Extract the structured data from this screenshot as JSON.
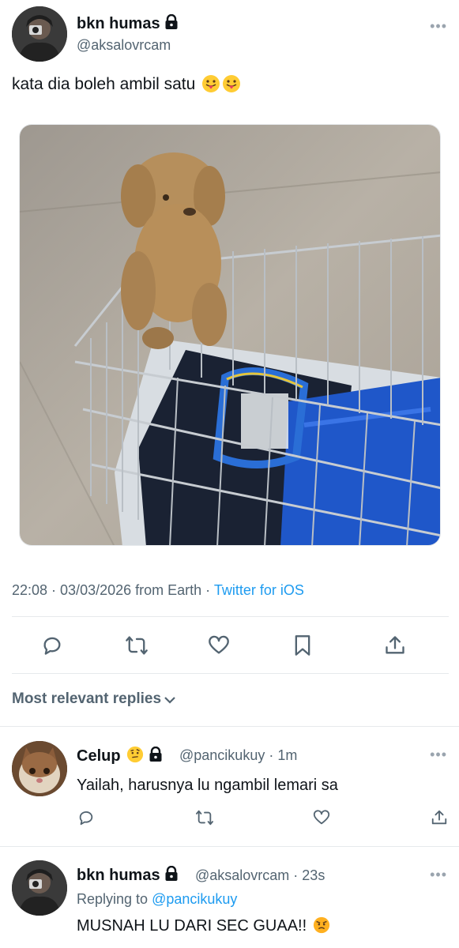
{
  "tweet": {
    "author_name": "bkn humas",
    "author_handle": "@aksalovrcam",
    "text": "kata dia boleh ambil satu",
    "timestamp": "22:08 · 03/03/2026 from Earth · ",
    "client": "Twitter for iOS",
    "icons": [
      "lock-icon",
      "tongue-emoji",
      "more-icon",
      "reply-icon",
      "retweet-icon",
      "like-icon",
      "bookmark-icon",
      "share-icon"
    ]
  },
  "replies_header": {
    "label": "Most relevant replies"
  },
  "replies": [
    {
      "author_name": "Celup",
      "author_handle": "@pancikukuy · 1m",
      "text": "Yailah, harusnya lu ngambil lemari sa"
    },
    {
      "author_name": "bkn humas",
      "author_handle": "@aksalovrcam · 23s",
      "replying_prefix": "Replying to ",
      "replying_to": "@pancikukuy",
      "text": "MUSNAH LU DARI SEC GUAA!!"
    }
  ],
  "colors": {
    "accent": "#1d9bf0",
    "secondary_text": "#536471",
    "divider": "#e6e9ec"
  }
}
